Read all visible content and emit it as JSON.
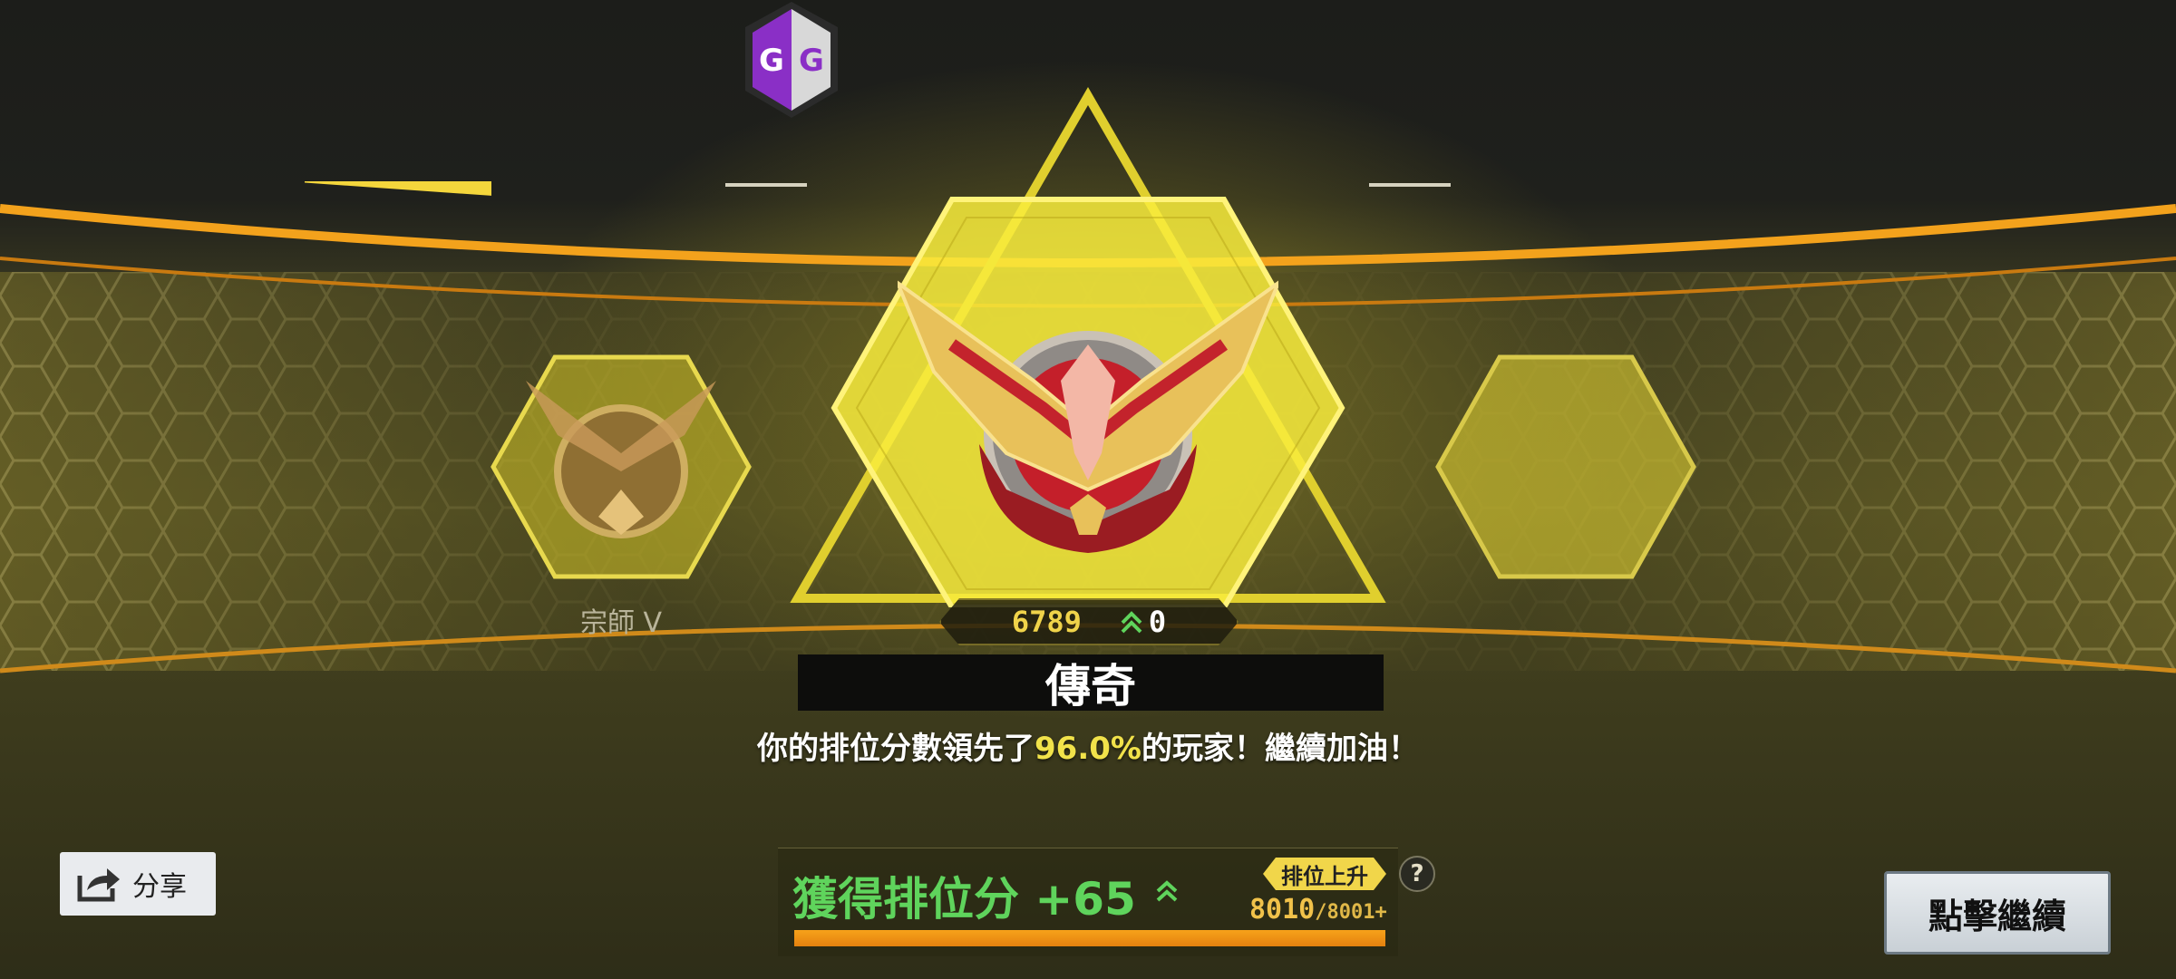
{
  "overlay": {
    "gg_letters": [
      "G",
      "G"
    ]
  },
  "rank": {
    "previous_name": "宗師 V",
    "current_title": "傳奇",
    "score": "6789",
    "score_change": "0",
    "percentile_prefix": "你的排位分數領先了",
    "percentile_value": "96.0%",
    "percentile_suffix": "的玩家！繼續加油！"
  },
  "gain": {
    "label": "獲得排位分 +65",
    "promotion_tag": "排位上升",
    "help": "?",
    "progress_current": "8010",
    "progress_max": "/8001+",
    "progress_fraction": 1.0
  },
  "buttons": {
    "share_label": "分享",
    "continue_label": "點擊繼續"
  },
  "colors": {
    "accent_yellow": "#f1e24a",
    "gain_green": "#5fd45c",
    "progress_orange": "#f7a21a",
    "gg_purple": "#8a2fc6"
  },
  "icons": {
    "share": "share-icon",
    "up": "double-chevron-up-icon",
    "help": "question-icon",
    "gg": "game-guardian-icon"
  }
}
